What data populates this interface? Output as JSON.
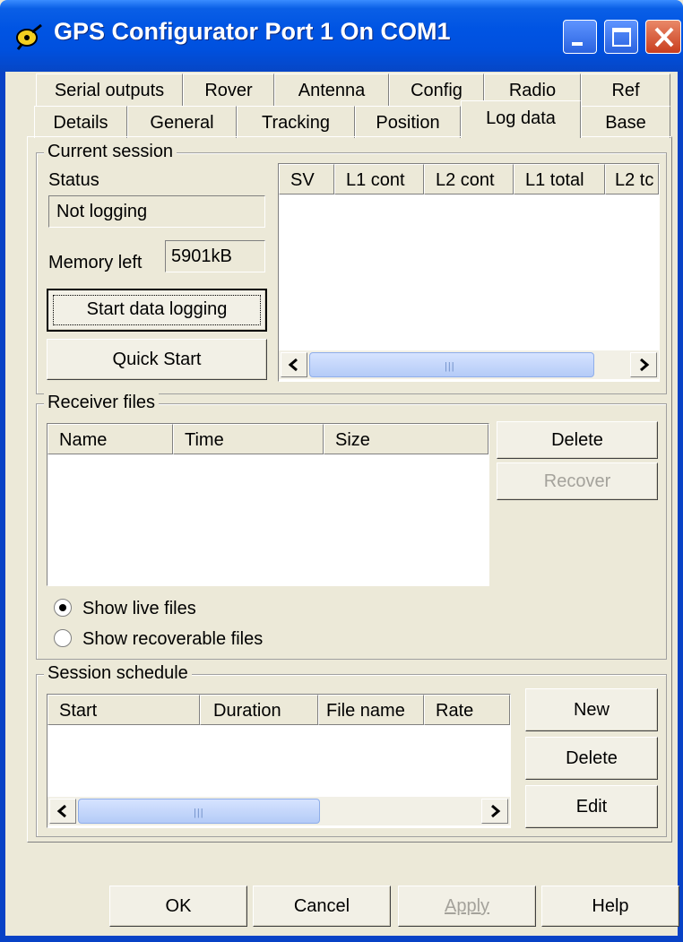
{
  "window": {
    "title": "GPS Configurator Port 1 On COM1"
  },
  "tabs_top": [
    "Serial outputs",
    "Rover",
    "Antenna",
    "Config",
    "Radio",
    "Ref"
  ],
  "tabs_bottom": [
    "Details",
    "General",
    "Tracking",
    "Position",
    "Log data",
    "Base"
  ],
  "active_tab": "Log data",
  "current_session": {
    "title": "Current session",
    "status_label": "Status",
    "status_value": "Not logging",
    "memory_label": "Memory left",
    "memory_value": "5901kB",
    "start_button": "Start data logging",
    "quick_button": "Quick Start",
    "columns": [
      "SV",
      "L1 cont",
      "L2 cont",
      "L1 total",
      "L2 tc"
    ]
  },
  "receiver_files": {
    "title": "Receiver files",
    "columns": [
      "Name",
      "Time",
      "Size"
    ],
    "delete_button": "Delete",
    "recover_button": "Recover",
    "radio_live": "Show live files",
    "radio_recoverable": "Show recoverable files",
    "selected": "live"
  },
  "session_schedule": {
    "title": "Session schedule",
    "columns": [
      "Start",
      "Duration",
      "File name",
      "Rate"
    ],
    "new_button": "New",
    "delete_button": "Delete",
    "edit_button": "Edit"
  },
  "footer": {
    "ok": "OK",
    "cancel": "Cancel",
    "apply": "Apply",
    "help": "Help"
  },
  "colors": {
    "titlebar": "#0054E3",
    "face": "#ECE9D8",
    "close": "#C93E1E"
  }
}
